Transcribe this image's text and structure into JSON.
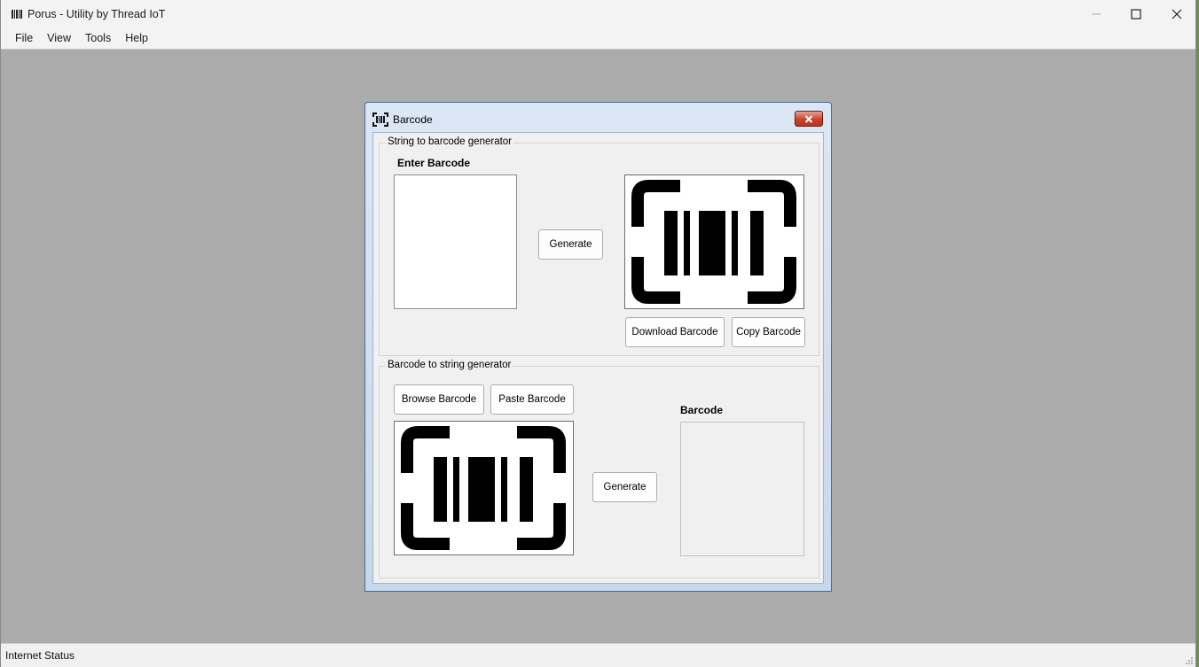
{
  "window": {
    "title": "Porus - Utility by Thread IoT",
    "icon": "app-barcode-icon",
    "controls": [
      "minimize-icon",
      "maximize-icon",
      "close-icon"
    ]
  },
  "menu": {
    "items": [
      {
        "label": "File"
      },
      {
        "label": "View"
      },
      {
        "label": "Tools"
      },
      {
        "label": "Help"
      }
    ]
  },
  "dialog": {
    "title": "Barcode",
    "icon": "barcode-scan-icon",
    "string_to_barcode": {
      "group_title": "String to barcode generator",
      "input_label": "Enter Barcode",
      "input_value": "",
      "generate_label": "Generate",
      "preview_icon": "barcode-scan-icon",
      "download_label": "Download Barcode",
      "copy_label": "Copy Barcode"
    },
    "barcode_to_string": {
      "group_title": "Barcode to string generator",
      "browse_label": "Browse Barcode",
      "paste_label": "Paste Barcode",
      "preview_icon": "barcode-scan-icon",
      "generate_label": "Generate",
      "output_label": "Barcode",
      "output_value": ""
    }
  },
  "status": {
    "label": "Internet Status"
  },
  "colors": {
    "mdi_background": "#ababab",
    "dialog_frame": "#c6d8ec",
    "close_button": "#c9432c"
  }
}
